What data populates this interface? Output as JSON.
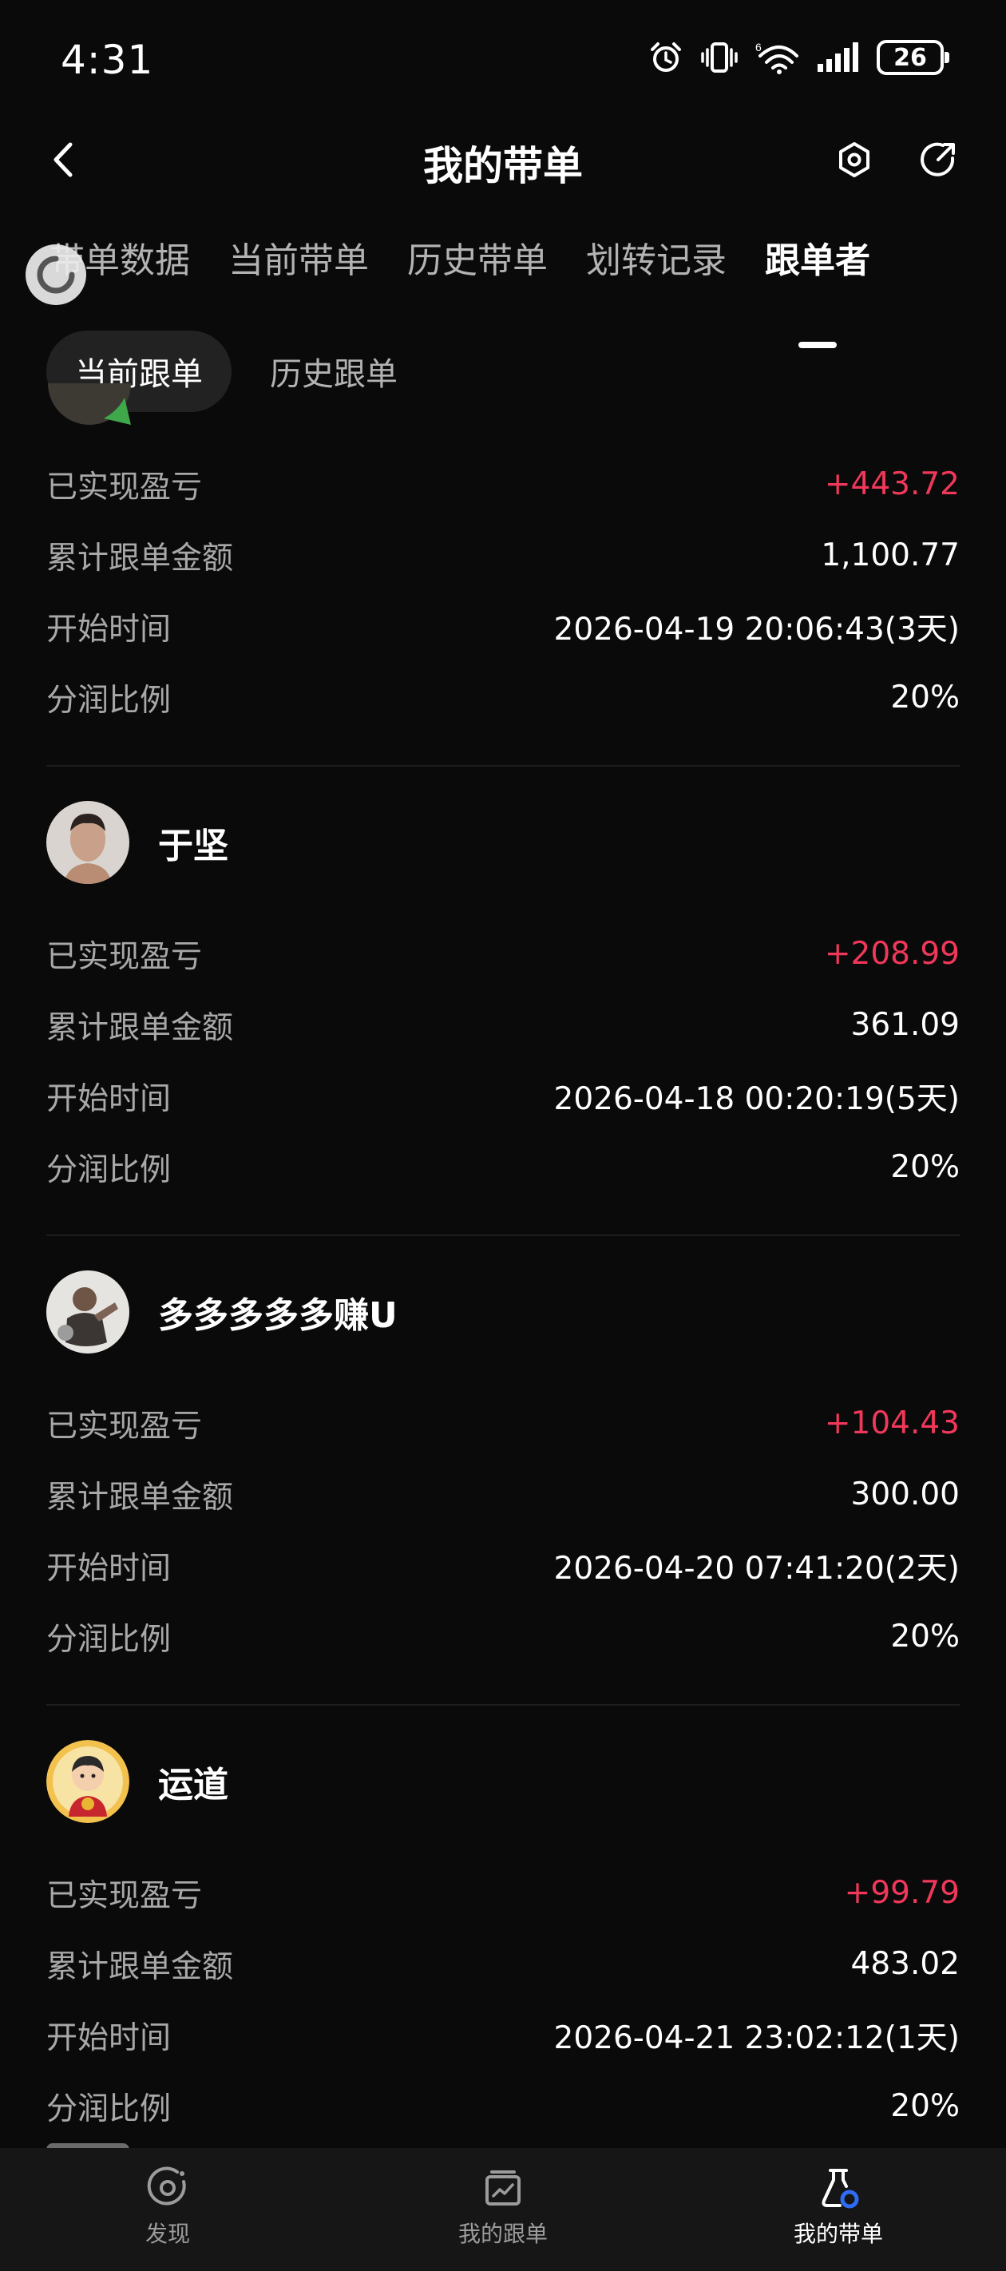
{
  "status_bar": {
    "time": "4:31",
    "battery": "26",
    "icons": [
      "alarm-icon",
      "vibrate-icon",
      "wifi-icon",
      "signal-icon",
      "battery-icon"
    ]
  },
  "header": {
    "title": "我的带单",
    "icons": [
      "back-icon",
      "settings-icon",
      "share-icon"
    ]
  },
  "tabs": [
    {
      "label": "带单数据",
      "active": false
    },
    {
      "label": "当前带单",
      "active": false
    },
    {
      "label": "历史带单",
      "active": false
    },
    {
      "label": "划转记录",
      "active": false
    },
    {
      "label": "跟单者",
      "active": true
    }
  ],
  "subtabs": [
    {
      "label": "当前跟单",
      "active": true
    },
    {
      "label": "历史跟单",
      "active": false
    }
  ],
  "labels": {
    "pnl": "已实现盈亏",
    "amount": "累计跟单金额",
    "start": "开始时间",
    "share": "分润比例"
  },
  "followers": [
    {
      "name": "",
      "pnl": "+443.72",
      "amount": "1,100.77",
      "start": "2026-04-19 20:06:43(3天)",
      "share": "20%"
    },
    {
      "name": "于坚",
      "pnl": "+208.99",
      "amount": "361.09",
      "start": "2026-04-18 00:20:19(5天)",
      "share": "20%"
    },
    {
      "name": "多多多多多赚U",
      "pnl": "+104.43",
      "amount": "300.00",
      "start": "2026-04-20 07:41:20(2天)",
      "share": "20%"
    },
    {
      "name": "运道",
      "pnl": "+99.79",
      "amount": "483.02",
      "start": "2026-04-21 23:02:12(1天)",
      "share": "20%"
    }
  ],
  "bottom_nav": [
    {
      "label": "发现",
      "icon": "discover-icon",
      "active": false
    },
    {
      "label": "我的跟单",
      "icon": "my-copy-icon",
      "active": false
    },
    {
      "label": "我的带单",
      "icon": "my-lead-icon",
      "active": true
    }
  ],
  "colors": {
    "background": "#0a0a0a",
    "profit": "#f0385a",
    "nav_background": "#161616",
    "active_dot": "#2f6cf6"
  }
}
